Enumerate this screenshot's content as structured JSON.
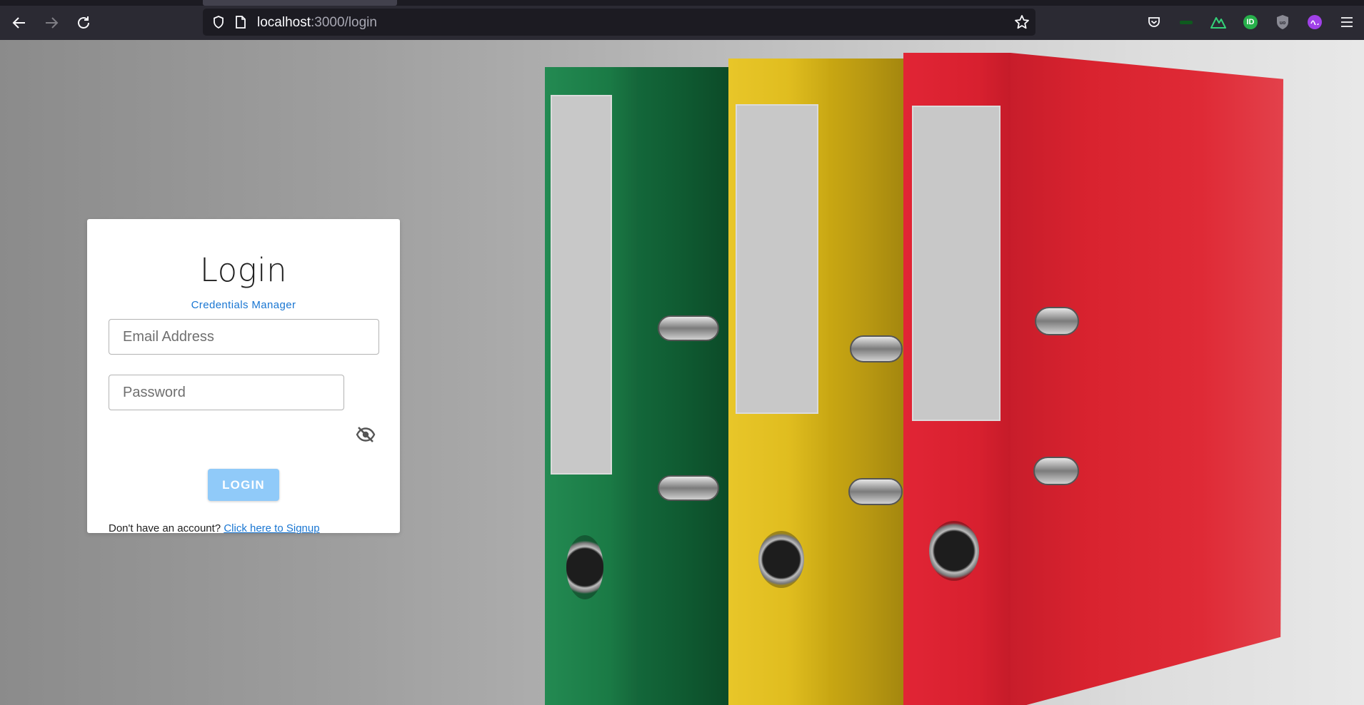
{
  "browser": {
    "url_host": "localhost",
    "url_rest": ":3000/login"
  },
  "login": {
    "title": "Login",
    "subtitle": "Credentials Manager",
    "email_placeholder": "Email Address",
    "password_placeholder": "Password",
    "login_button": "LOGIN",
    "signup_prompt": "Don't have an account?",
    "signup_link": "Click here to Signup"
  },
  "colors": {
    "primary": "#1976d2",
    "button_disabled": "#90caf9",
    "binder_green": "#1a7a45",
    "binder_yellow": "#e0bd1f",
    "binder_red": "#d8202f"
  }
}
